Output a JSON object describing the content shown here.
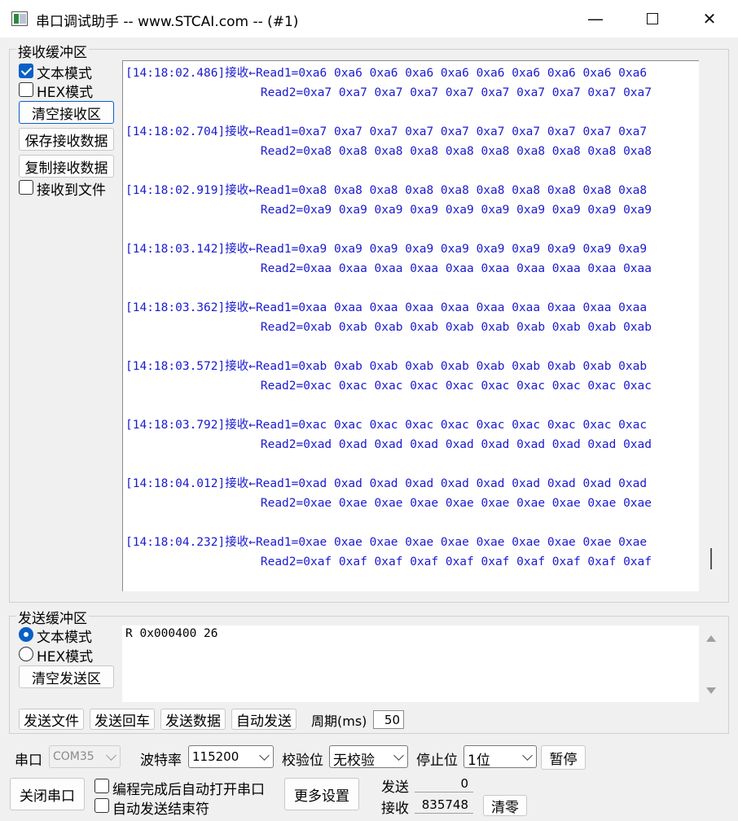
{
  "window": {
    "title": "串口调试助手 -- www.STCAI.com -- (#1)",
    "minimize_glyph": "—",
    "close_glyph": "✕"
  },
  "receive": {
    "group_label": "接收缓冲区",
    "text_mode_label": "文本模式",
    "text_mode_checked": true,
    "hex_mode_label": "HEX模式",
    "hex_mode_checked": false,
    "clear_button": "清空接收区",
    "save_button": "保存接收数据",
    "copy_button": "复制接收数据",
    "to_file_label": "接收到文件",
    "to_file_checked": false,
    "lines": [
      "[14:18:02.486]接收←Read1=0xa6 0xa6 0xa6 0xa6 0xa6 0xa6 0xa6 0xa6 0xa6 0xa6",
      "                   Read2=0xa7 0xa7 0xa7 0xa7 0xa7 0xa7 0xa7 0xa7 0xa7 0xa7",
      "",
      "[14:18:02.704]接收←Read1=0xa7 0xa7 0xa7 0xa7 0xa7 0xa7 0xa7 0xa7 0xa7 0xa7",
      "                   Read2=0xa8 0xa8 0xa8 0xa8 0xa8 0xa8 0xa8 0xa8 0xa8 0xa8",
      "",
      "[14:18:02.919]接收←Read1=0xa8 0xa8 0xa8 0xa8 0xa8 0xa8 0xa8 0xa8 0xa8 0xa8",
      "                   Read2=0xa9 0xa9 0xa9 0xa9 0xa9 0xa9 0xa9 0xa9 0xa9 0xa9",
      "",
      "[14:18:03.142]接收←Read1=0xa9 0xa9 0xa9 0xa9 0xa9 0xa9 0xa9 0xa9 0xa9 0xa9",
      "                   Read2=0xaa 0xaa 0xaa 0xaa 0xaa 0xaa 0xaa 0xaa 0xaa 0xaa",
      "",
      "[14:18:03.362]接收←Read1=0xaa 0xaa 0xaa 0xaa 0xaa 0xaa 0xaa 0xaa 0xaa 0xaa",
      "                   Read2=0xab 0xab 0xab 0xab 0xab 0xab 0xab 0xab 0xab 0xab",
      "",
      "[14:18:03.572]接收←Read1=0xab 0xab 0xab 0xab 0xab 0xab 0xab 0xab 0xab 0xab",
      "                   Read2=0xac 0xac 0xac 0xac 0xac 0xac 0xac 0xac 0xac 0xac",
      "",
      "[14:18:03.792]接收←Read1=0xac 0xac 0xac 0xac 0xac 0xac 0xac 0xac 0xac 0xac",
      "                   Read2=0xad 0xad 0xad 0xad 0xad 0xad 0xad 0xad 0xad 0xad",
      "",
      "[14:18:04.012]接收←Read1=0xad 0xad 0xad 0xad 0xad 0xad 0xad 0xad 0xad 0xad",
      "                   Read2=0xae 0xae 0xae 0xae 0xae 0xae 0xae 0xae 0xae 0xae",
      "",
      "[14:18:04.232]接收←Read1=0xae 0xae 0xae 0xae 0xae 0xae 0xae 0xae 0xae 0xae",
      "                   Read2=0xaf 0xaf 0xaf 0xaf 0xaf 0xaf 0xaf 0xaf 0xaf 0xaf"
    ]
  },
  "send": {
    "group_label": "发送缓冲区",
    "text_mode_label": "文本模式",
    "text_mode_selected": true,
    "hex_mode_label": "HEX模式",
    "clear_button": "清空发送区",
    "text": "R 0x000400 26",
    "send_file_button": "发送文件",
    "send_enter_button": "发送回车",
    "send_data_button": "发送数据",
    "auto_send_button": "自动发送",
    "period_label": "周期(ms)",
    "period_value": "50"
  },
  "port": {
    "port_label": "串口",
    "port_value": "COM35",
    "baud_label": "波特率",
    "baud_value": "115200",
    "parity_label": "校验位",
    "parity_value": "无校验",
    "stop_label": "停止位",
    "stop_value": "1位",
    "pause_button": "暂停",
    "close_port_button": "关闭串口",
    "auto_open_label": "编程完成后自动打开串口",
    "auto_open_checked": false,
    "auto_end_label": "自动发送结束符",
    "auto_end_checked": false,
    "more_settings_button": "更多设置",
    "sent_label": "发送",
    "sent_count": "0",
    "recv_label": "接收",
    "recv_count": "835748",
    "clear_count_button": "清零"
  }
}
